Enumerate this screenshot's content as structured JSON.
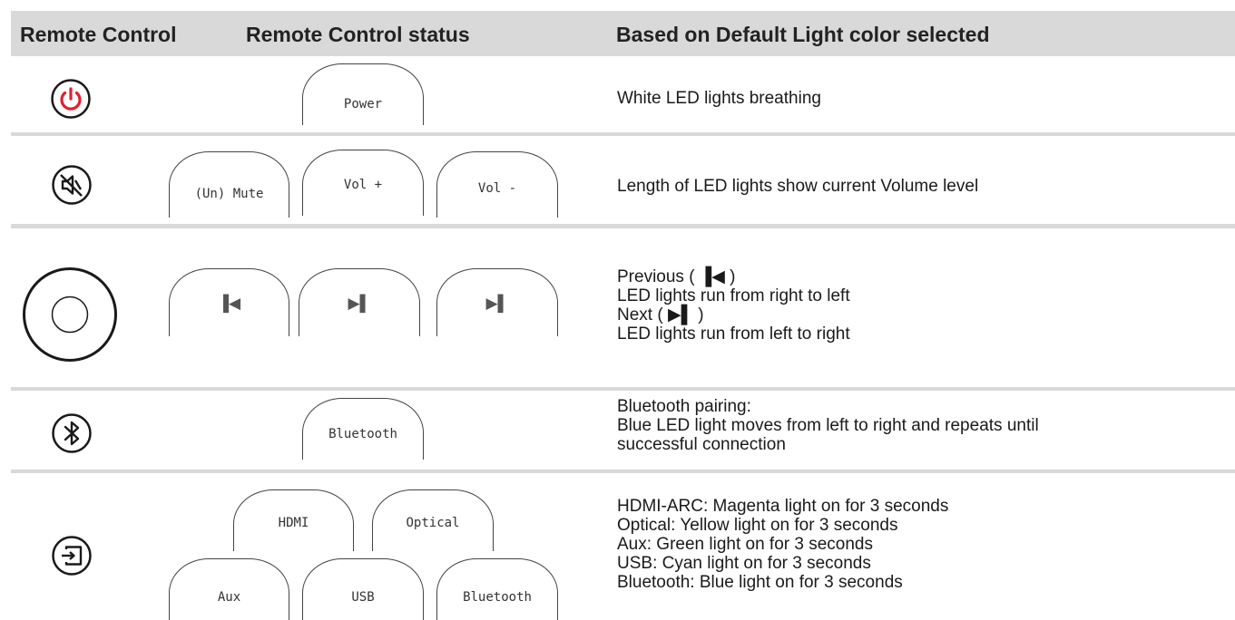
{
  "header": {
    "col1": "Remote Control",
    "col2": "Remote Control status",
    "col3": "Based on Default Light color selected"
  },
  "rows": [
    {
      "icon": "power-icon",
      "icon_color": "#e02030",
      "buttons": [
        "Power"
      ],
      "description": [
        "White LED lights breathing"
      ]
    },
    {
      "icon": "mute-icon",
      "buttons": [
        "(Un) Mute",
        "Vol +",
        "Vol -"
      ],
      "description": [
        "Length of LED lights show current Volume level"
      ]
    },
    {
      "icon": "navigation-ring-icon",
      "buttons": [
        "previous-icon",
        "play-pause-icon",
        "next-icon"
      ],
      "description": [
        "Previous ( ▐◀ )",
        "LED lights run from right to left",
        "Next ( ▶▌ )",
        "LED lights run from left to right"
      ]
    },
    {
      "icon": "bluetooth-icon",
      "buttons": [
        "Bluetooth"
      ],
      "description": [
        "Bluetooth pairing:",
        "Blue LED light moves from left to right and repeats until",
        "successful connection"
      ]
    },
    {
      "icon": "source-input-icon",
      "buttons": [
        "HDMI",
        "Optical",
        "Aux",
        "USB",
        "Bluetooth"
      ],
      "description": [
        "HDMI-ARC: Magenta light on for 3 seconds",
        "Optical: Yellow light on for 3 seconds",
        "Aux: Green light on for 3 seconds",
        "USB: Cyan light on for 3 seconds",
        "Bluetooth: Blue light on for 3 seconds"
      ]
    }
  ]
}
